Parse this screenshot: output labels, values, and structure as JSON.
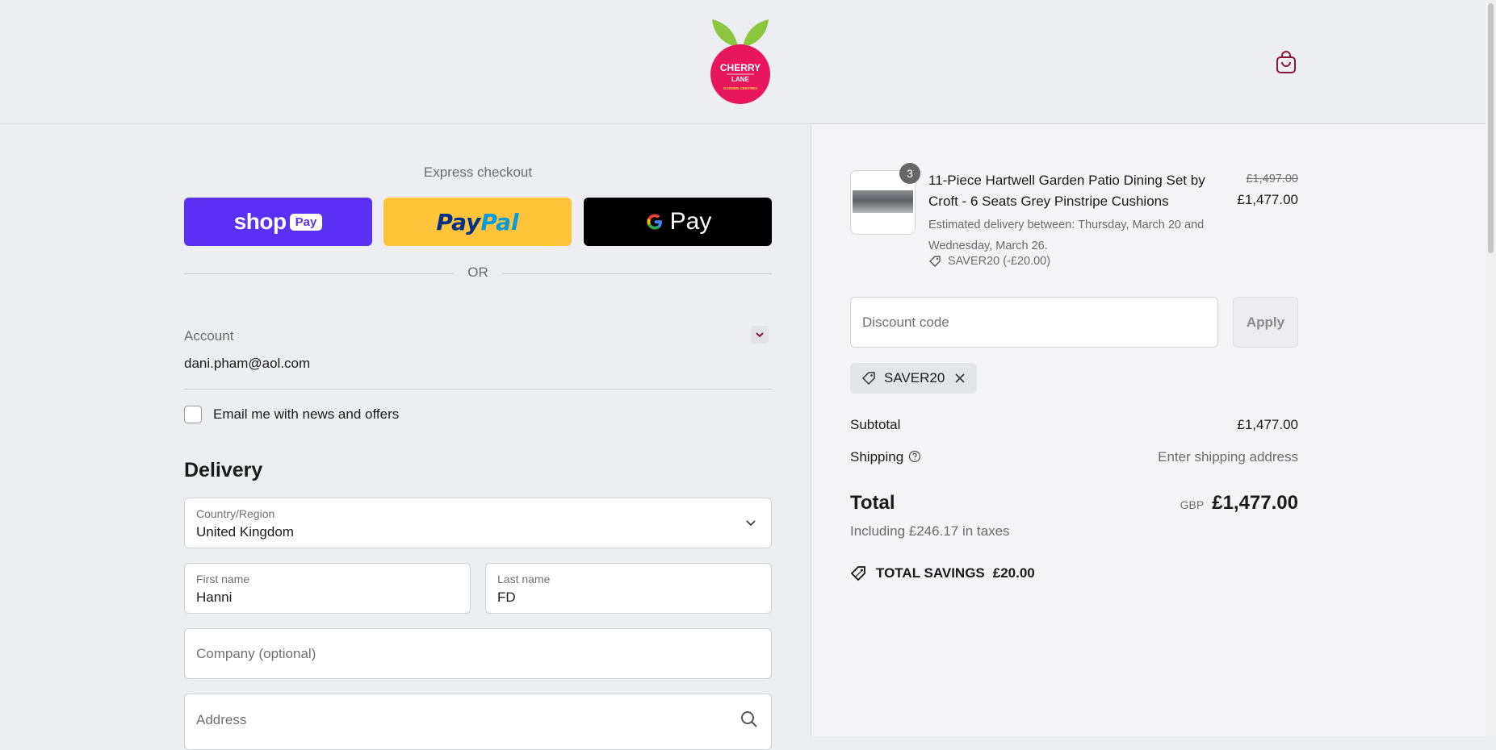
{
  "header": {
    "logo": {
      "line1": "CHERRY",
      "line2": "LANE",
      "line3": "GARDEN CENTRES"
    },
    "cart_icon": "shopping-bag-icon"
  },
  "express": {
    "title": "Express checkout",
    "shop_pay": {
      "word": "shop",
      "tag": "Pay"
    },
    "paypal": {
      "part1": "Pay",
      "part2": "Pal"
    },
    "gpay": {
      "g": "G",
      "word": "Pay"
    },
    "or_text": "OR"
  },
  "account": {
    "label": "Account",
    "email": "dani.pham@aol.com",
    "newsletter_label": "Email me with news and offers"
  },
  "delivery": {
    "title": "Delivery",
    "country": {
      "label": "Country/Region",
      "value": "United Kingdom"
    },
    "first_name": {
      "label": "First name",
      "value": "Hanni"
    },
    "last_name": {
      "label": "Last name",
      "value": "FD"
    },
    "company": {
      "placeholder": "Company (optional)"
    },
    "address": {
      "placeholder": "Address"
    }
  },
  "order": {
    "item": {
      "quantity": "3",
      "title": "11-Piece Hartwell Garden Patio Dining Set by Croft - 6 Seats Grey Pinstripe Cushions",
      "delivery": "Estimated delivery between: Thursday, March 20 and Wednesday, March 26.",
      "discount": "SAVER20 (-£20.00)",
      "price_original": "£1,497.00",
      "price": "£1,477.00"
    },
    "discount_placeholder": "Discount code",
    "apply_label": "Apply",
    "applied_code": "SAVER20",
    "subtotal_label": "Subtotal",
    "subtotal_value": "£1,477.00",
    "shipping_label": "Shipping",
    "shipping_value": "Enter shipping address",
    "total_label": "Total",
    "total_currency": "GBP",
    "total_value": "£1,477.00",
    "tax_line": "Including £246.17 in taxes",
    "savings_label": "TOTAL SAVINGS",
    "savings_value": "£20.00"
  },
  "colors": {
    "brand": "#e8175d",
    "leaf": "#8cc63f",
    "shop_pay": "#5a31f4",
    "paypal": "#ffc43a",
    "gpay": "#000000"
  }
}
